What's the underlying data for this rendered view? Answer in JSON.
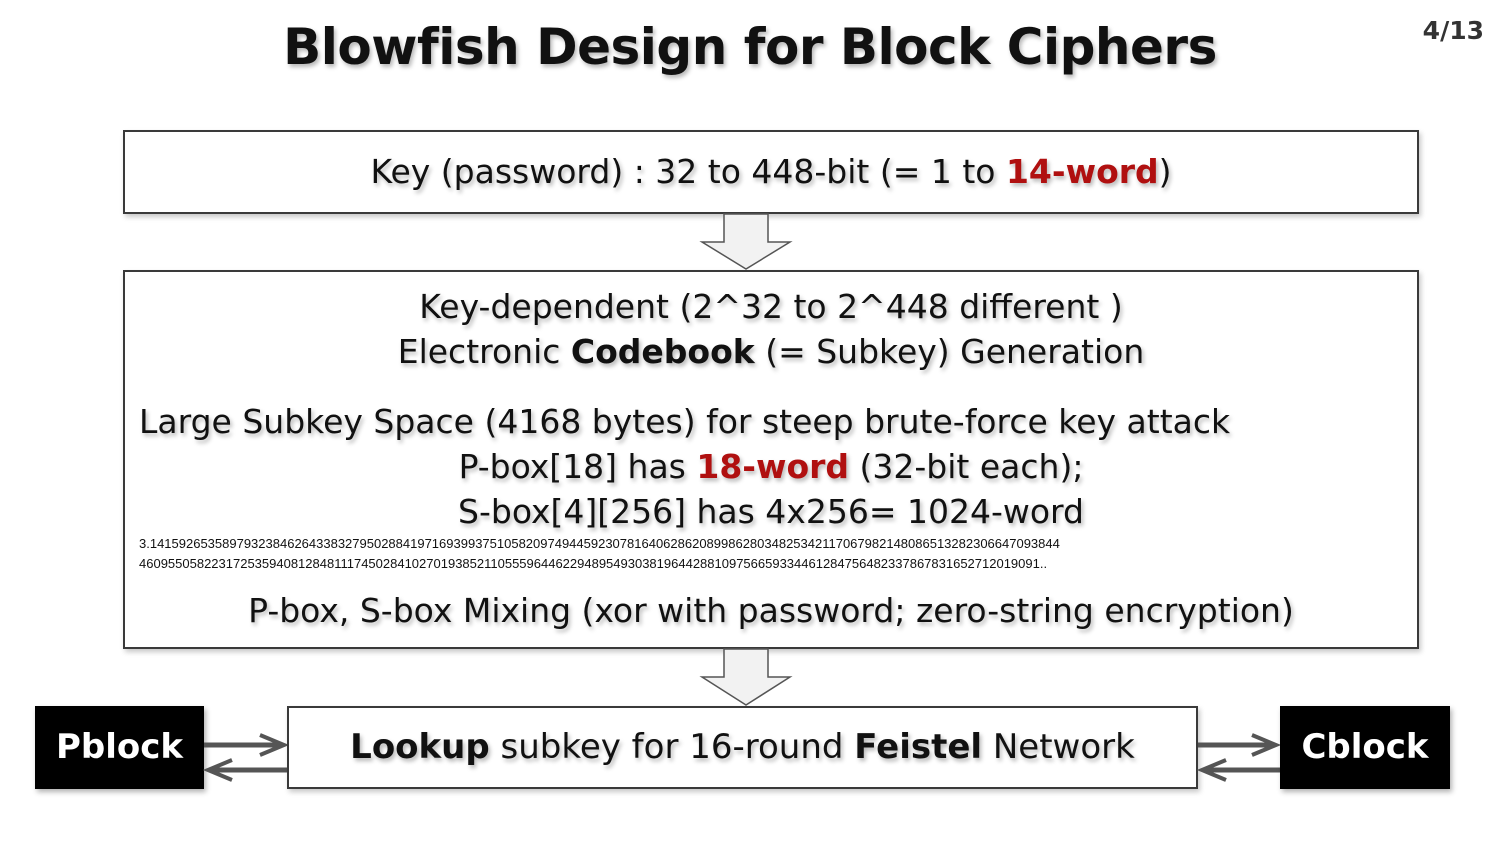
{
  "title": "Blowfish Design for Block Ciphers",
  "page_number": "4/13",
  "key_box": {
    "prefix": "Key (password) : 32 to 448-bit (= 1 to ",
    "highlight": "14-word",
    "suffix": ")"
  },
  "codebook_box": {
    "line1": "Key-dependent (2^32 to 2^448 different )",
    "line2_pre": "Electronic ",
    "line2_bold": "Codebook",
    "line2_post": " (= Subkey) Generation",
    "line3": "Large Subkey Space (4168 bytes) for steep brute-force key attack",
    "line4_pre": "P-box[18] has ",
    "line4_highlight": "18-word",
    "line4_post": " (32-bit each);",
    "line5": "S-box[4][256] has 4x256= 1024-word",
    "pi_line1": "3.141592653589793238462643383279502884197169399375105820974944592307816406286208998628034825342117067982148086513282306647093844",
    "pi_line2": "46095505822317253594081284811174502841027019385211055596446229489549303819644288109756659334461284756482337867831652712019091..",
    "line6": "P-box, S-box Mixing (xor with password; zero-string encryption)"
  },
  "lookup_box": {
    "bold1": "Lookup",
    "mid": " subkey for 16-round ",
    "bold2": "Feistel",
    "end": " Network"
  },
  "pblock_label": "Pblock",
  "cblock_label": "Cblock",
  "colors": {
    "highlight": "#b01010",
    "block_bg": "#000000",
    "arrow_fill": "#f2f2f2",
    "arrow_stroke": "#555555"
  }
}
